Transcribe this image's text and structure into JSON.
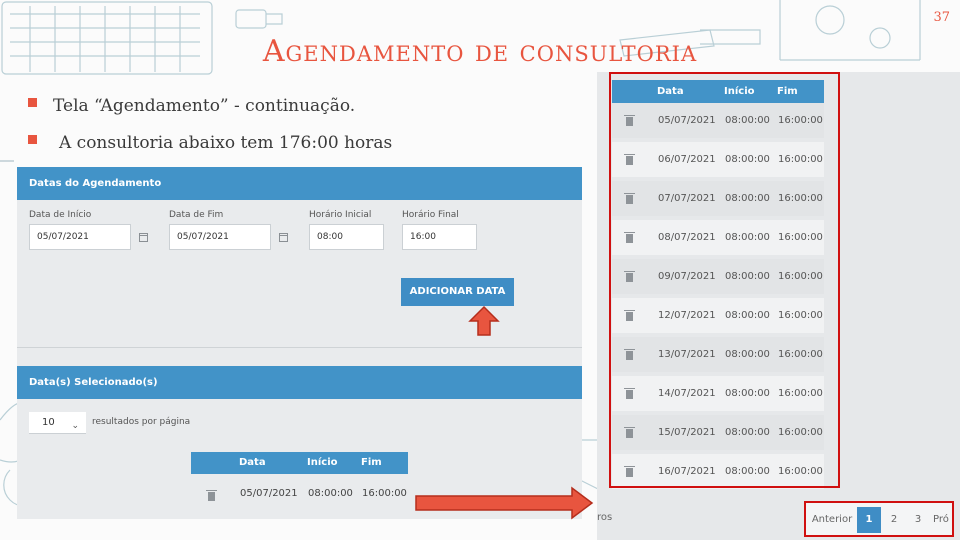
{
  "slide": {
    "number": "37",
    "title": "Agendamento de consultoria",
    "bullets": [
      "Tela “Agendamento” - continuação.",
      "A consultoria abaixo tem 176:00 horas"
    ]
  },
  "form_panel": {
    "header": "Datas do Agendamento",
    "fields": {
      "start_date_label": "Data de Início",
      "start_date_value": "05/07/2021",
      "end_date_label": "Data de Fim",
      "end_date_value": "05/07/2021",
      "start_time_label": "Horário Inicial",
      "start_time_value": "08:00",
      "end_time_label": "Horário Final",
      "end_time_value": "16:00"
    },
    "add_button": "ADICIONAR DATA"
  },
  "selected_panel": {
    "header": "Data(s) Selecionado(s)",
    "results_per_page": "10",
    "results_label": "resultados por página",
    "columns": [
      "Data",
      "Início",
      "Fim"
    ],
    "rows": [
      {
        "date": "05/07/2021",
        "start": "08:00:00",
        "end": "16:00:00"
      }
    ]
  },
  "zoom_table": {
    "columns": [
      "Data",
      "Início",
      "Fim"
    ],
    "rows": [
      {
        "date": "05/07/2021",
        "start": "08:00:00",
        "end": "16:00:00"
      },
      {
        "date": "06/07/2021",
        "start": "08:00:00",
        "end": "16:00:00"
      },
      {
        "date": "07/07/2021",
        "start": "08:00:00",
        "end": "16:00:00"
      },
      {
        "date": "08/07/2021",
        "start": "08:00:00",
        "end": "16:00:00"
      },
      {
        "date": "09/07/2021",
        "start": "08:00:00",
        "end": "16:00:00"
      },
      {
        "date": "12/07/2021",
        "start": "08:00:00",
        "end": "16:00:00"
      },
      {
        "date": "13/07/2021",
        "start": "08:00:00",
        "end": "16:00:00"
      },
      {
        "date": "14/07/2021",
        "start": "08:00:00",
        "end": "16:00:00"
      },
      {
        "date": "15/07/2021",
        "start": "08:00:00",
        "end": "16:00:00"
      },
      {
        "date": "16/07/2021",
        "start": "08:00:00",
        "end": "16:00:00"
      }
    ],
    "footer_fragment": "ros"
  },
  "pagination": {
    "previous": "Anterior",
    "pages": [
      "1",
      "2",
      "3"
    ],
    "active_page": "1",
    "next_fragment": "Pró"
  },
  "colors": {
    "accent": "#e8553f",
    "header_blue": "#4293c8",
    "highlight_red": "#d01010"
  }
}
